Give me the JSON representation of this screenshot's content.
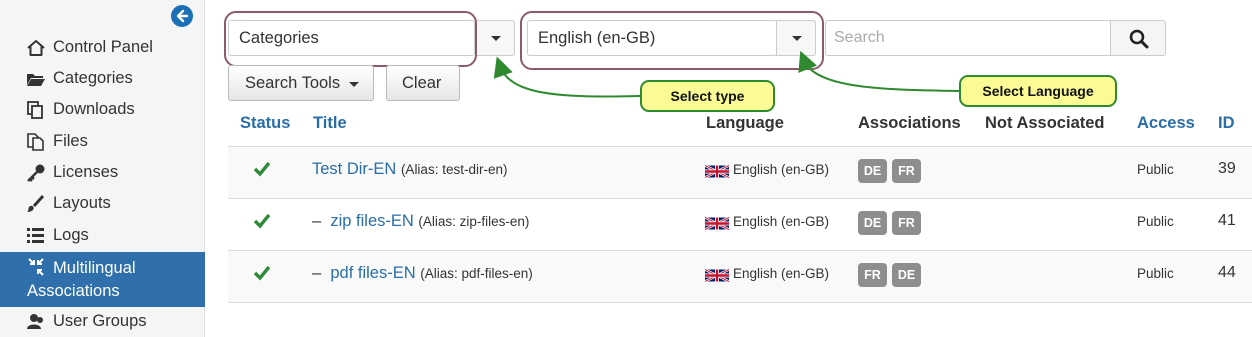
{
  "sidebar": {
    "items": [
      {
        "label": "Control Panel",
        "icon": "home-icon"
      },
      {
        "label": "Categories",
        "icon": "folder-icon"
      },
      {
        "label": "Downloads",
        "icon": "copy-icon"
      },
      {
        "label": "Files",
        "icon": "file-icon"
      },
      {
        "label": "Licenses",
        "icon": "key-icon"
      },
      {
        "label": "Layouts",
        "icon": "brush-icon"
      },
      {
        "label": "Logs",
        "icon": "list-icon"
      },
      {
        "label_line1": "Multilingual",
        "label_line2": "Associations",
        "icon": "shrink-icon",
        "active": true
      },
      {
        "label": "User Groups",
        "icon": "users-icon"
      }
    ]
  },
  "toolbar": {
    "type_select_value": "Categories",
    "language_select_value": "English (en-GB)",
    "search_placeholder": "Search",
    "search_tools_label": "Search Tools",
    "clear_label": "Clear"
  },
  "callouts": {
    "select_type": "Select type",
    "select_language": "Select Language"
  },
  "table": {
    "headers": {
      "status": "Status",
      "title": "Title",
      "language": "Language",
      "associations": "Associations",
      "not_associated": "Not Associated",
      "access": "Access",
      "id": "ID"
    },
    "rows": [
      {
        "prefix": "",
        "title": "Test Dir-EN",
        "alias": "(Alias: test-dir-en)",
        "language": "English (en-GB)",
        "assoc": [
          "DE",
          "FR"
        ],
        "access": "Public",
        "id": "39"
      },
      {
        "prefix": "–",
        "title": "zip files-EN",
        "alias": "(Alias: zip-files-en)",
        "language": "English (en-GB)",
        "assoc": [
          "DE",
          "FR"
        ],
        "access": "Public",
        "id": "41"
      },
      {
        "prefix": "–",
        "title": "pdf files-EN",
        "alias": "(Alias: pdf-files-en)",
        "language": "English (en-GB)",
        "assoc": [
          "FR",
          "DE"
        ],
        "access": "Public",
        "id": "44"
      }
    ]
  },
  "colors": {
    "sidebar_active": "#2f6fac",
    "link": "#2a6ea8",
    "check": "#2e8b3a",
    "callout_fill": "#fbfb96",
    "callout_border": "#2f8a2f",
    "highlight_border": "#8b5a6b",
    "badge": "#8e8e8e"
  }
}
